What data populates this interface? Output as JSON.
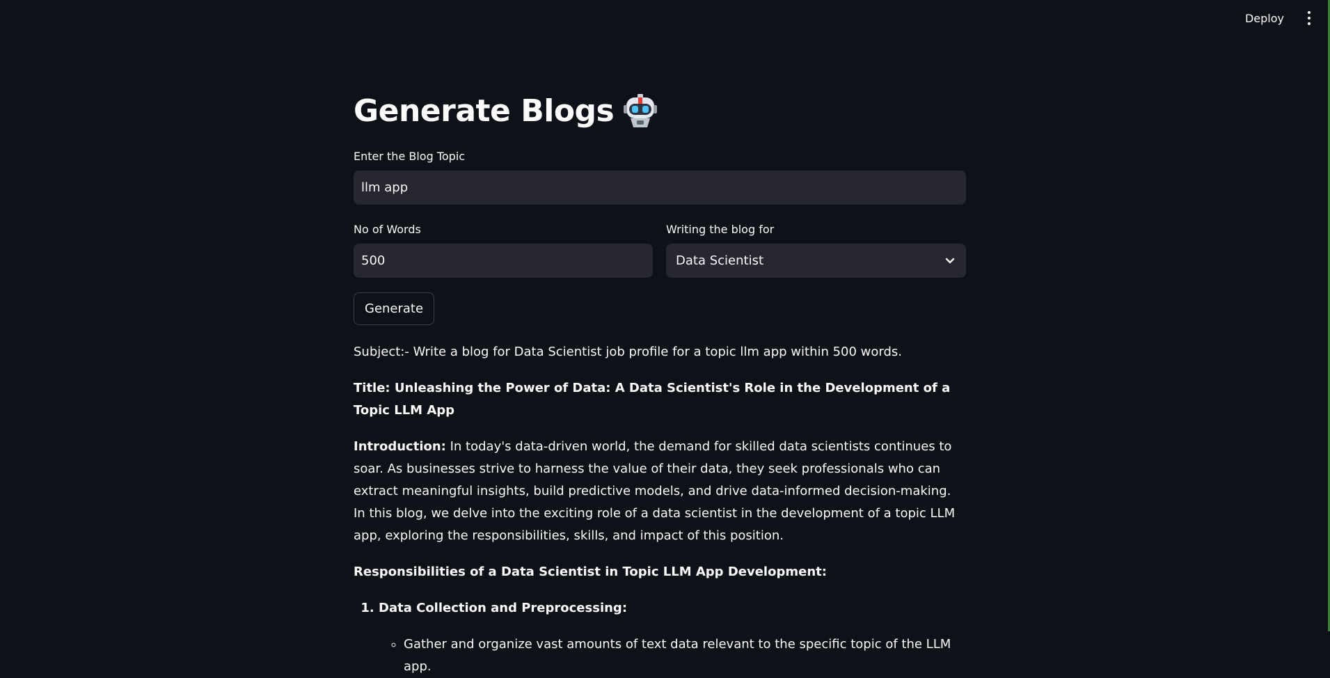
{
  "toolbar": {
    "deploy_label": "Deploy",
    "menu_icon": "kebab-menu-icon"
  },
  "page": {
    "title": "Generate Blogs",
    "title_icon": "robot-emoji-icon"
  },
  "form": {
    "topic_label": "Enter the Blog Topic",
    "topic_value": "llm app",
    "words_label": "No of Words",
    "words_value": "500",
    "audience_label": "Writing the blog for",
    "audience_value": "Data Scientist",
    "generate_label": "Generate"
  },
  "output": {
    "subject": "Subject:- Write a blog for Data Scientist job profile for a topic llm app within 500 words.",
    "title": "Title: Unleashing the Power of Data: A Data Scientist's Role in the Development of a Topic LLM App",
    "intro_label": "Introduction:",
    "intro_text": " In today's data-driven world, the demand for skilled data scientists continues to soar. As businesses strive to harness the value of their data, they seek professionals who can extract meaningful insights, build predictive models, and drive data-informed decision-making. In this blog, we delve into the exciting role of a data scientist in the development of a topic LLM app, exploring the responsibilities, skills, and impact of this position.",
    "responsibilities_heading": "Responsibilities of a Data Scientist in Topic LLM App Development:",
    "list_item_1": "Data Collection and Preprocessing:",
    "sub_item_1": "Gather and organize vast amounts of text data relevant to the specific topic of the LLM app."
  },
  "colors": {
    "background": "#0e1117",
    "input_bg": "#262730",
    "text": "#fafafa",
    "right_edge": "#3f7f3a"
  }
}
